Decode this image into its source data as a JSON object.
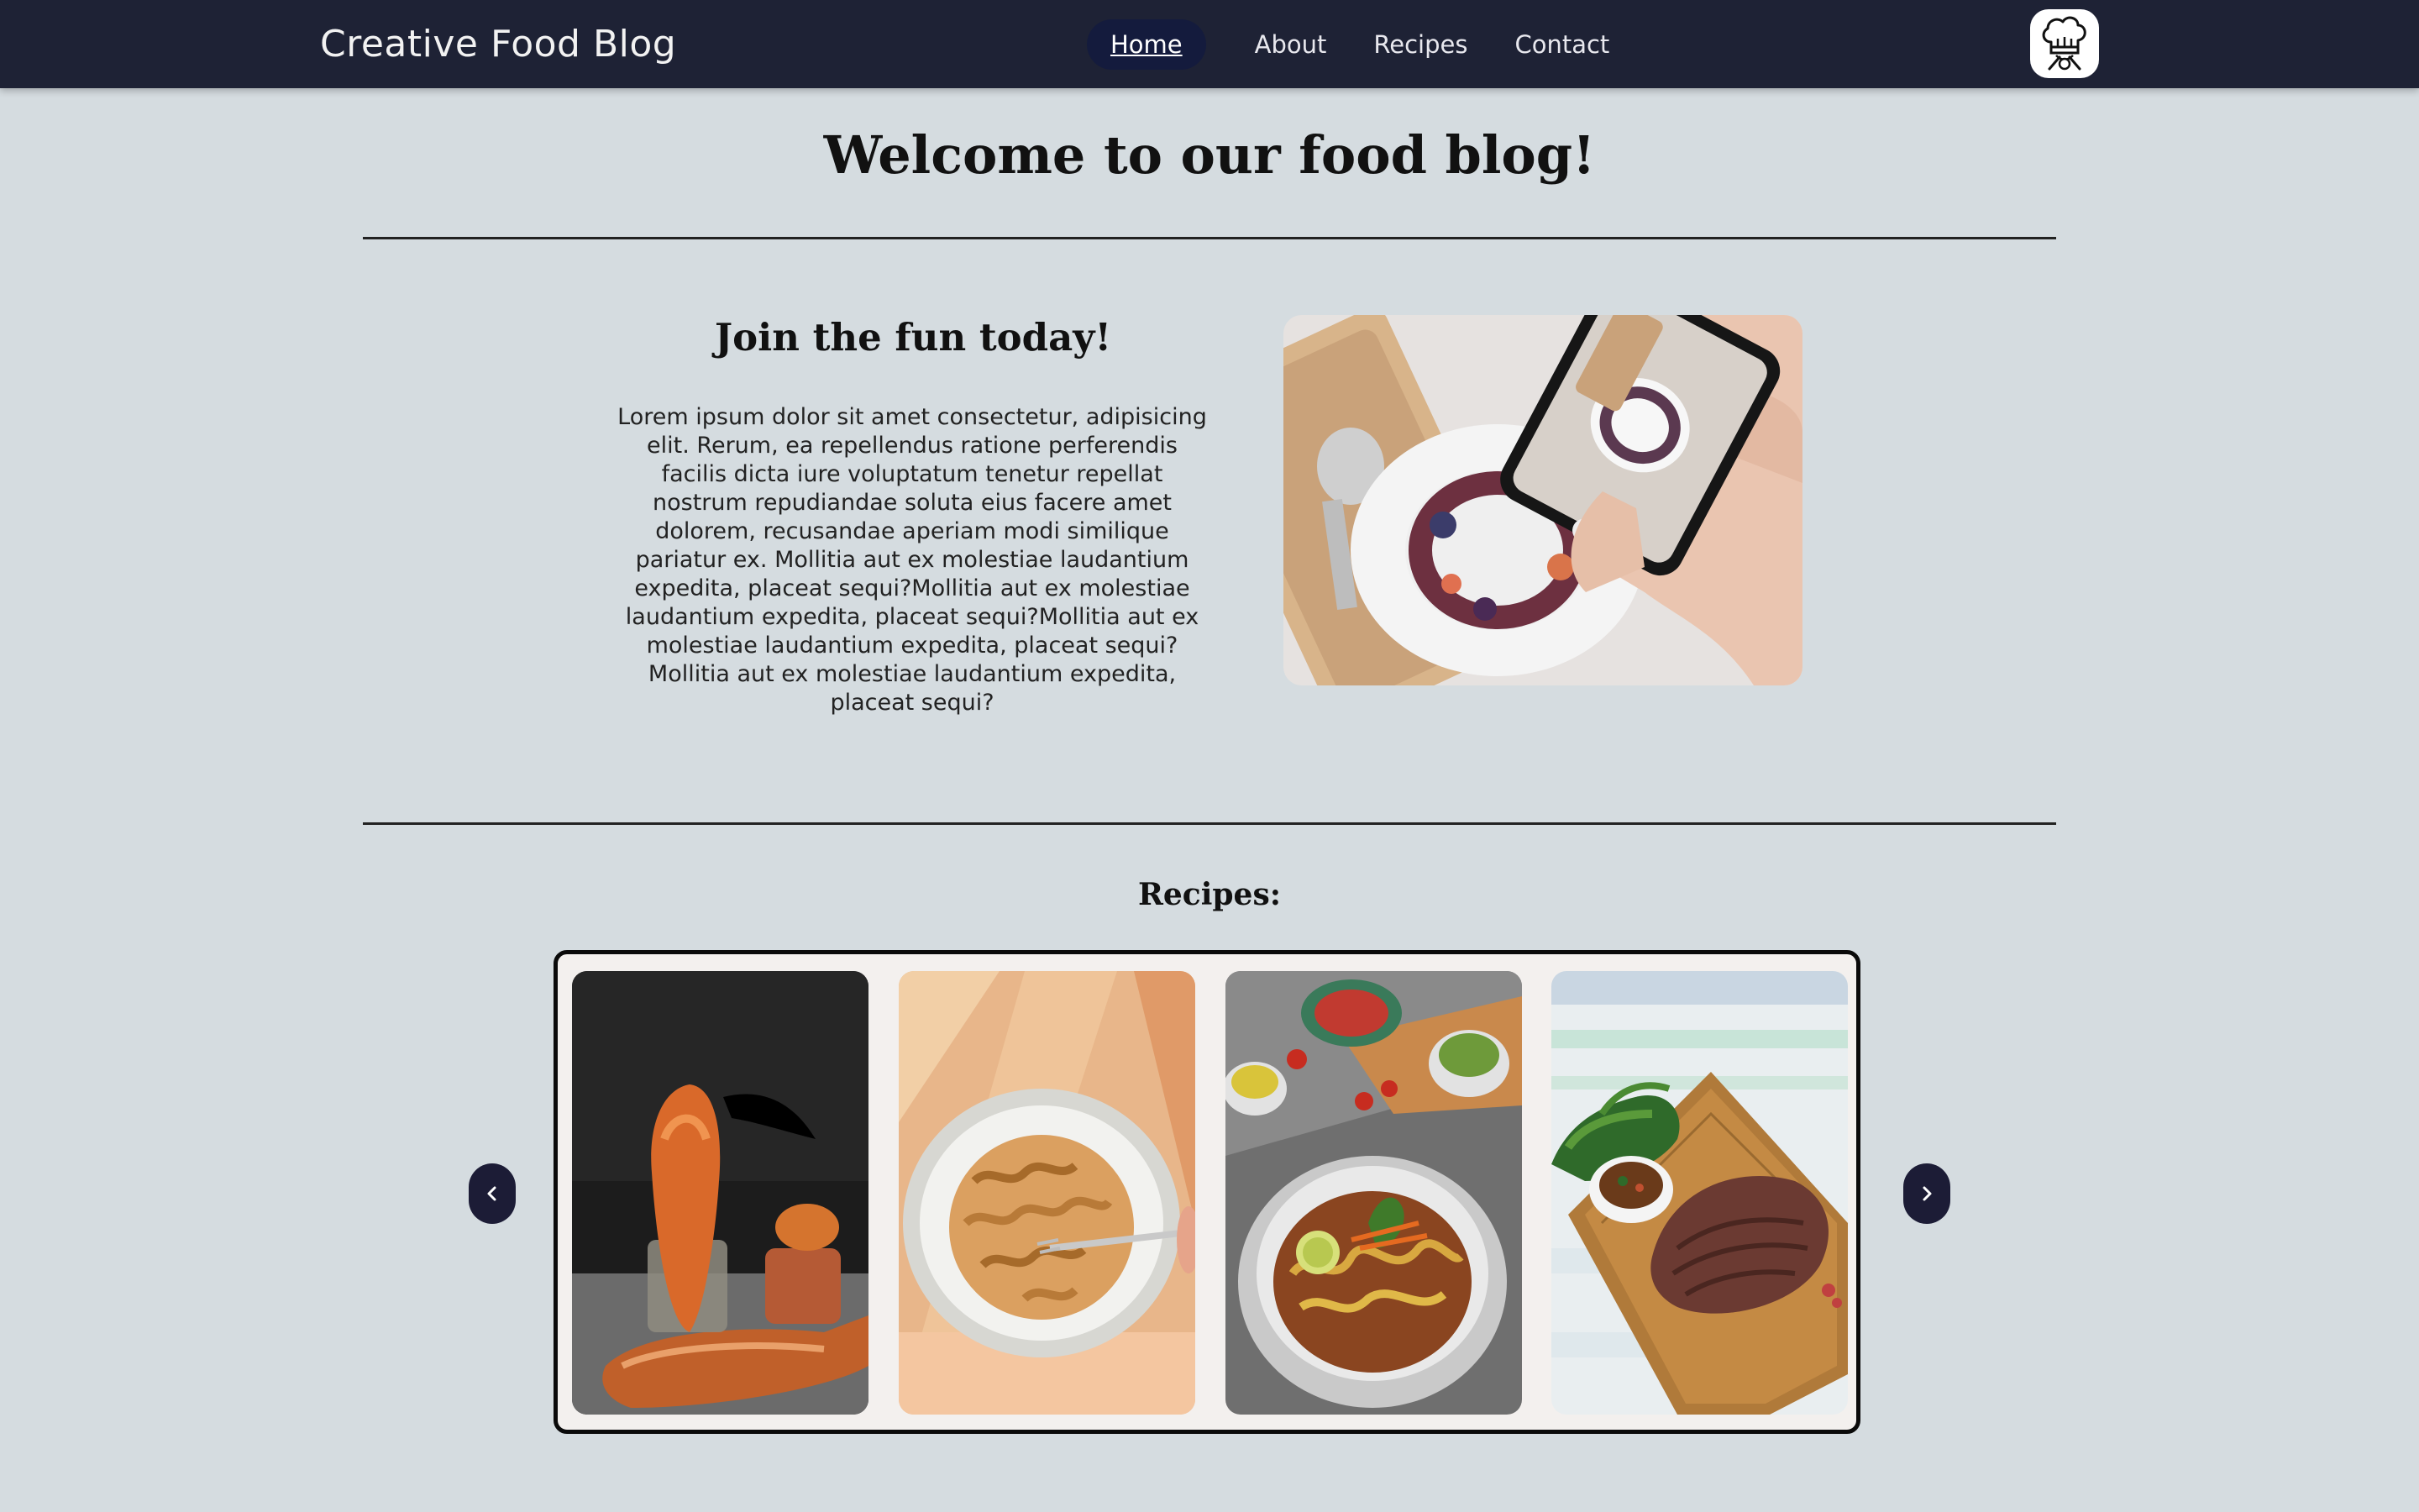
{
  "navbar": {
    "brand": "Creative Food Blog",
    "links": [
      {
        "label": "Home",
        "active": true
      },
      {
        "label": "About",
        "active": false
      },
      {
        "label": "Recipes",
        "active": false
      },
      {
        "label": "Contact",
        "active": false
      }
    ],
    "logo_icon": "chef-hat-icon"
  },
  "main": {
    "welcome_title": "Welcome to our food blog!",
    "join_title": "Join the fun today!",
    "join_body": "Lorem ipsum dolor sit amet consectetur, adipisicing elit. Rerum, ea repellendus ratione perferendis facilis dicta iure voluptatum tenetur repellat nostrum repudiandae soluta eius facere amet dolorem, recusandae aperiam modi similique pariatur ex. Mollitia aut ex molestiae laudantium expedita, placeat sequi?Mollitia aut ex molestiae laudantium expedita, placeat sequi?Mollitia aut ex molestiae laudantium expedita, placeat sequi?Mollitia aut ex molestiae laudantium expedita, placeat sequi?",
    "hero_image": "phone-photographing-dessert-image",
    "recipes_title": "Recipes:",
    "carousel": {
      "prev_icon": "chevron-left-icon",
      "next_icon": "chevron-right-icon",
      "cards": [
        {
          "image": "fried-snack-image"
        },
        {
          "image": "pasta-bowl-image"
        },
        {
          "image": "noodle-soup-image"
        },
        {
          "image": "steak-board-image"
        }
      ]
    }
  },
  "colors": {
    "navbar_bg": "#1e2235",
    "active_pill": "#141b3d",
    "page_bg": "#d5dce0",
    "carousel_bg": "#f3f0ee",
    "arrow_bg": "#1c1c36"
  }
}
